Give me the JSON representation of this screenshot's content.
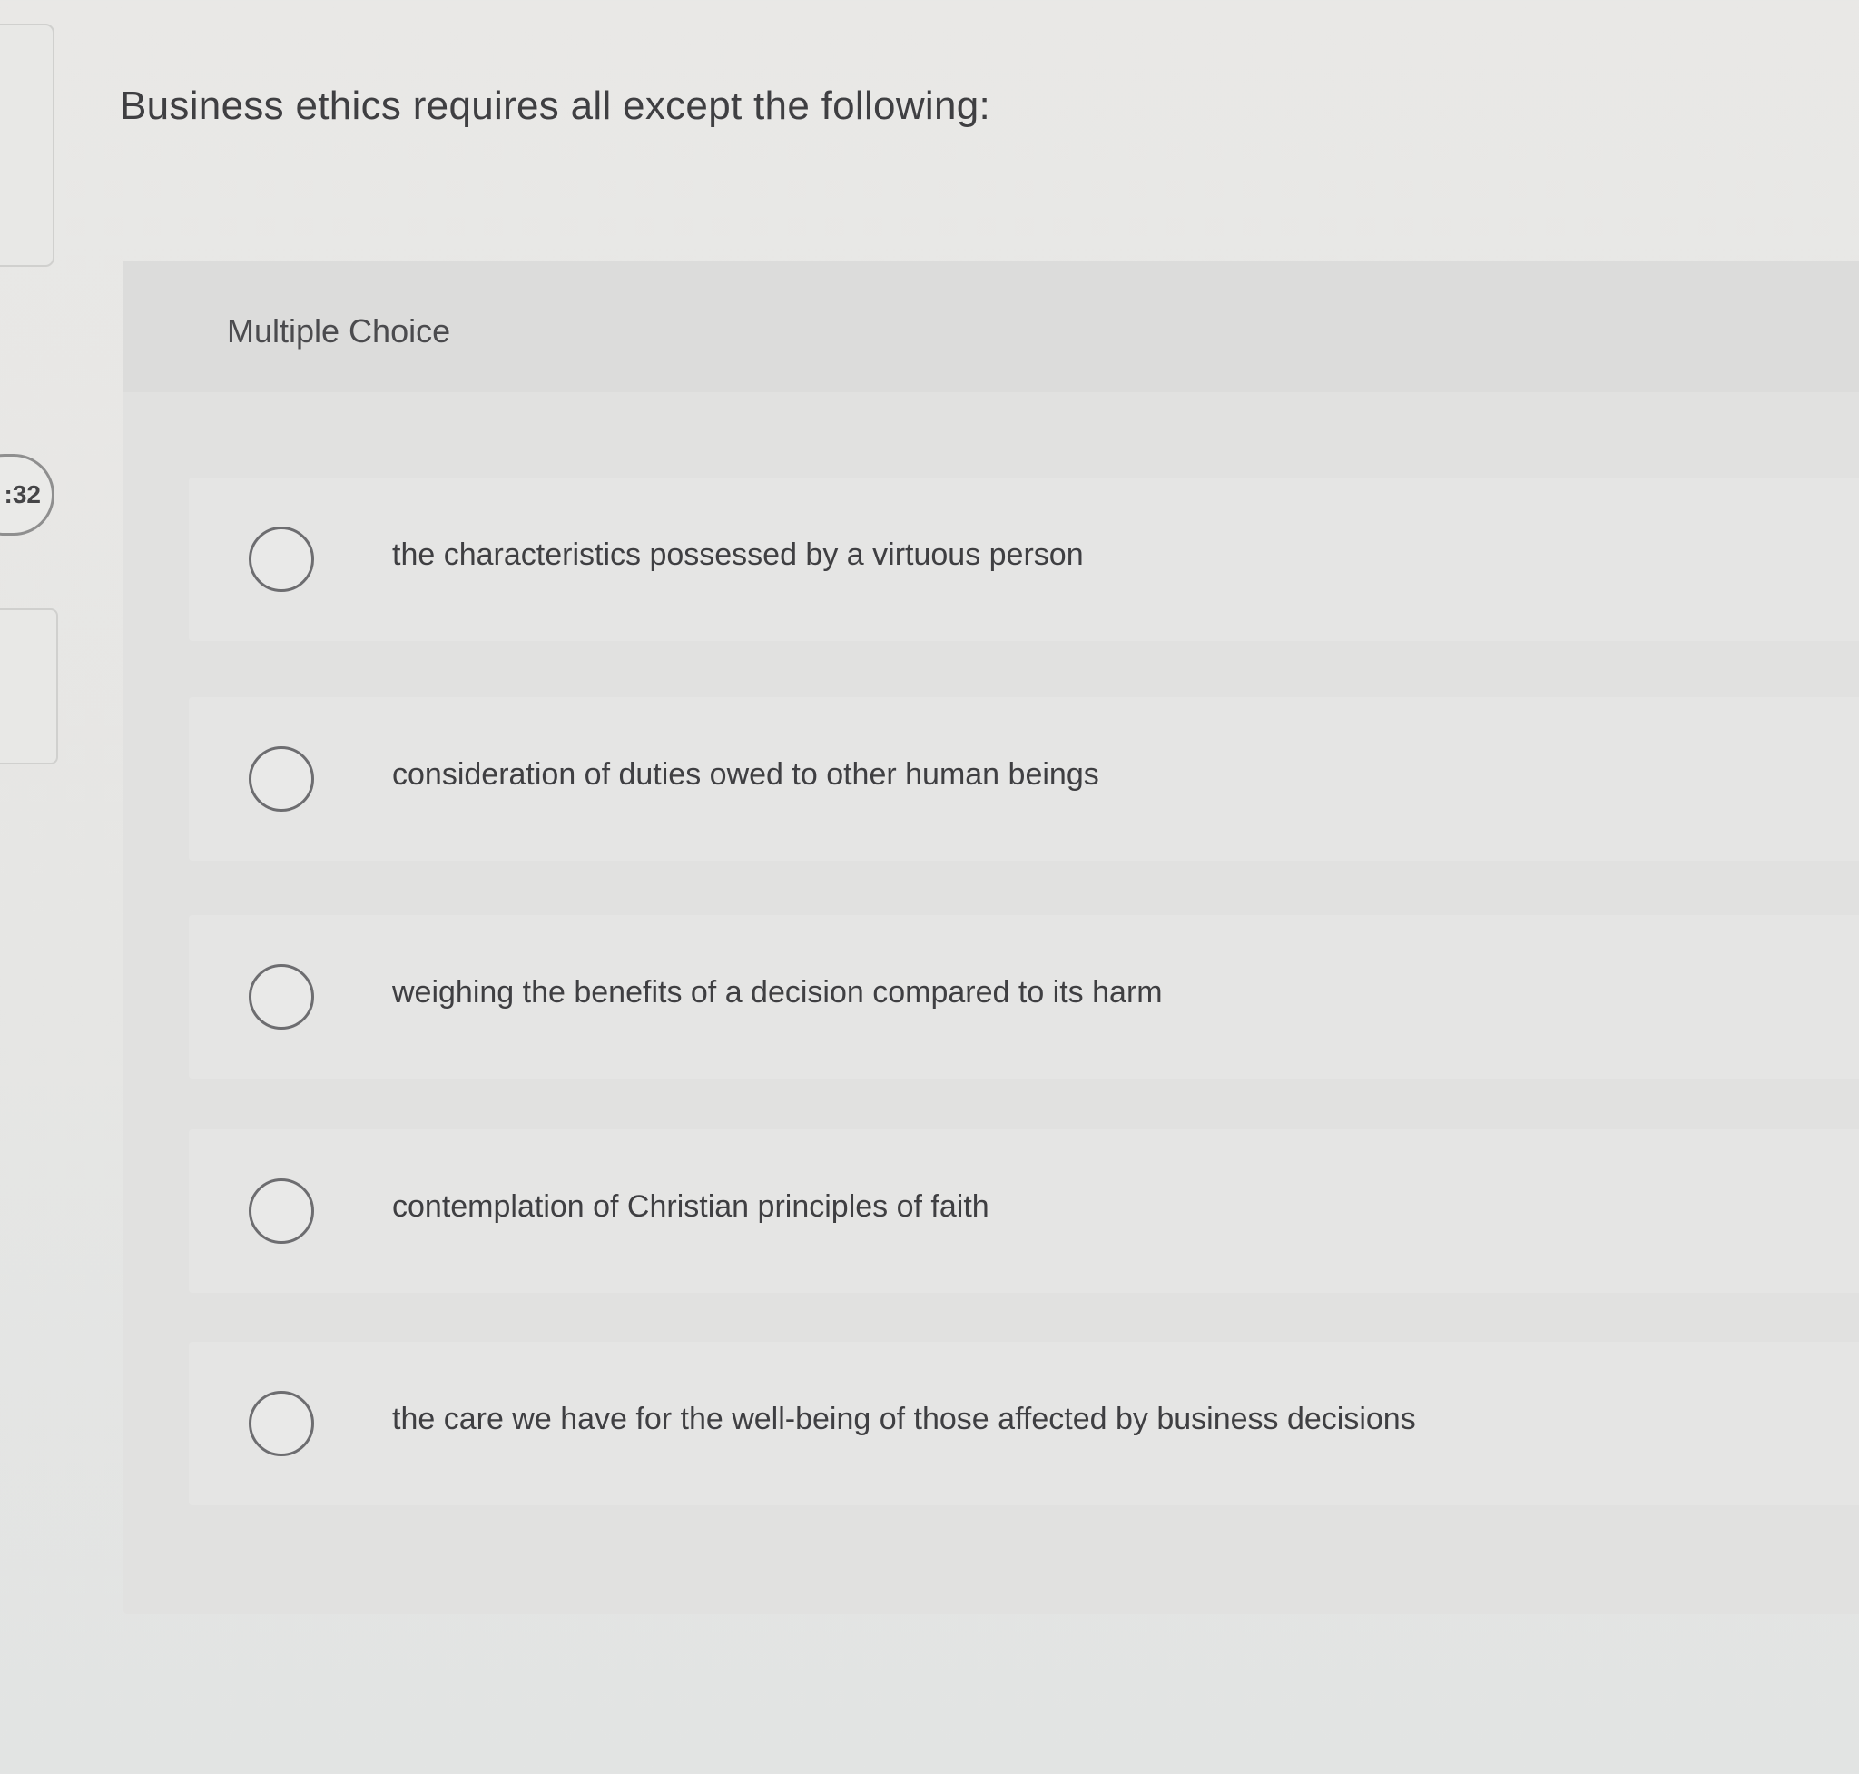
{
  "timer": {
    "text": ":32"
  },
  "question": {
    "text": "Business ethics requires all except the following:",
    "type_label": "Multiple Choice",
    "options": [
      {
        "label": "the characteristics possessed by a virtuous person"
      },
      {
        "label": "consideration of duties owed to other human beings"
      },
      {
        "label": "weighing the benefits of a decision compared to its harm"
      },
      {
        "label": "contemplation of Christian principles of faith"
      },
      {
        "label": "the care we have for the well-being of those affected by business decisions"
      }
    ]
  }
}
